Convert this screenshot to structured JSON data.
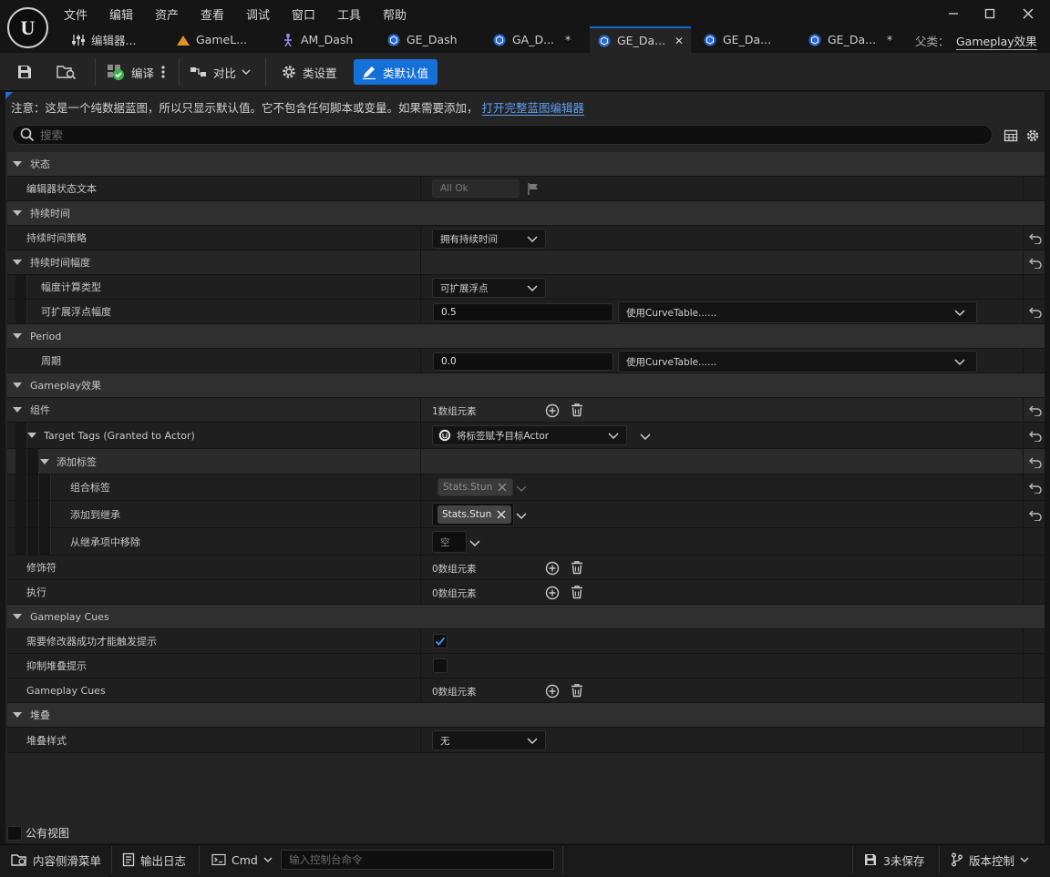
{
  "menu": [
    "文件",
    "编辑",
    "资产",
    "查看",
    "调试",
    "窗口",
    "工具",
    "帮助"
  ],
  "app_logo_text": "U",
  "tabs": [
    {
      "label": "编辑器...",
      "icon": "sliders-icon"
    },
    {
      "label": "GameL...",
      "icon": "chart-icon"
    },
    {
      "label": "AM_Dash",
      "icon": "animation-icon"
    },
    {
      "label": "GE_Dash",
      "icon": "blueprint-icon"
    },
    {
      "label": "GA_D...",
      "icon": "blueprint-icon",
      "dirty": "*"
    },
    {
      "label": "GE_Da...",
      "icon": "blueprint-icon",
      "active": true,
      "close": "✕"
    },
    {
      "label": "GE_Da...",
      "icon": "blueprint-icon"
    },
    {
      "label": "GE_Da...",
      "icon": "blueprint-icon",
      "dirty": "*"
    }
  ],
  "parent": {
    "label": "父类：",
    "value": "Gameplay效果"
  },
  "toolbar": {
    "compile": "编译",
    "diff": "对比",
    "class_settings": "类设置",
    "class_defaults": "类默认值"
  },
  "notice": {
    "text": "注意：这是一个纯数据蓝图，所以只显示默认值。它不包含任何脚本或变量。如果需要添加，",
    "link": "打开完整蓝图编辑器"
  },
  "search": {
    "placeholder": "搜索"
  },
  "details": {
    "status": {
      "category": "状态",
      "editor_status_label": "编辑器状态文本",
      "editor_status_value": "All Ok"
    },
    "duration": {
      "category": "持续时间",
      "policy_label": "持续时间策略",
      "policy_value": "拥有持续时间",
      "magnitude_label": "持续时间幅度",
      "calc_type_label": "幅度计算类型",
      "calc_type_value": "可扩展浮点",
      "scalable_label": "可扩展浮点幅度",
      "scalable_value": "0.5",
      "curve_value": "使用CurveTable......"
    },
    "period": {
      "category": "Period",
      "period_label": "周期",
      "period_value": "0.0",
      "curve_value": "使用CurveTable......"
    },
    "gameplay_effect": {
      "category": "Gameplay效果",
      "components_label": "组件",
      "components_value": "1数组元素",
      "target_tags_label": "Target Tags (Granted to Actor)",
      "target_tags_value": "将标签赋予目标Actor",
      "add_tags_label": "添加标签",
      "combined_label": "组合标签",
      "combined_tag": "Stats.Stun",
      "add_inherit_label": "添加到继承",
      "add_inherit_tag": "Stats.Stun",
      "remove_inherit_label": "从继承项中移除",
      "remove_inherit_value": "空",
      "modifiers_label": "修饰符",
      "modifiers_value": "0数组元素",
      "executions_label": "执行",
      "executions_value": "0数组元素"
    },
    "cues": {
      "category": "Gameplay Cues",
      "require_success_label": "需要修改器成功才能触发提示",
      "require_success_checked": true,
      "suppress_stacking_label": "抑制堆叠提示",
      "suppress_stacking_checked": false,
      "cues_label": "Gameplay Cues",
      "cues_value": "0数组元素"
    },
    "stacking": {
      "category": "堆叠",
      "style_label": "堆叠样式",
      "style_value": "无"
    }
  },
  "public_view_label": "公有视图",
  "statusbar": {
    "content_drawer": "内容侧滑菜单",
    "output_log": "输出日志",
    "cmd": "Cmd",
    "console_placeholder": "输入控制台命令",
    "unsaved": "3未保存",
    "source_control": "版本控制"
  },
  "colors": {
    "accent": "#1570d8",
    "link": "#5da0f0",
    "check": "#3b8ef0"
  }
}
